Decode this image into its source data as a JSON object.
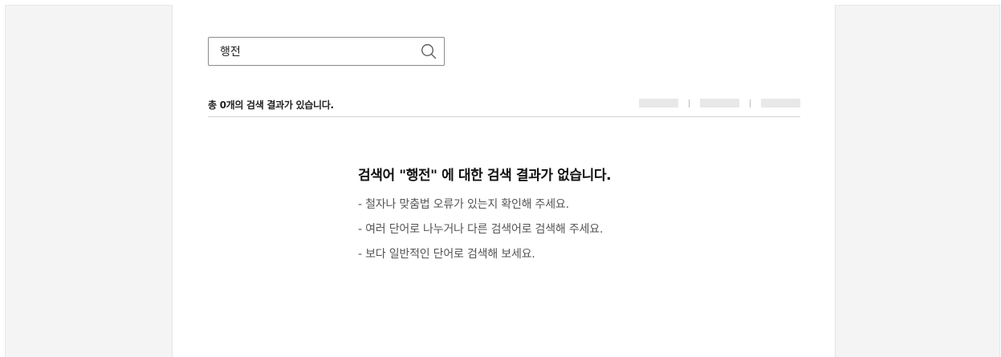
{
  "search": {
    "value": "행전",
    "icon": "search-icon"
  },
  "results": {
    "count_text": "총 0개의 검색 결과가 있습니다."
  },
  "no_result": {
    "title": "검색어 \"행전\" 에 대한 검색 결과가 없습니다.",
    "tips": [
      "- 철자나 맞춤법 오류가 있는지 확인해 주세요.",
      "- 여러 단어로 나누거나 다른 검색어로 검색해 주세요.",
      "- 보다 일반적인 단어로 검색해 보세요."
    ]
  },
  "colors": {
    "page_background": "#f4f4f4",
    "panel_background": "#ffffff",
    "border": "#8a8a8a",
    "divider": "#d0d0d0",
    "placeholder_bar": "#e8e8e8"
  }
}
